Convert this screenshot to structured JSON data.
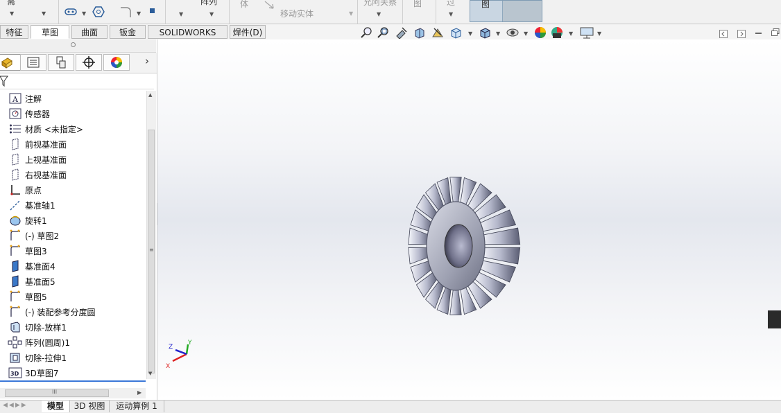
{
  "ribbon": {
    "partial_labels": [
      "需",
      "体",
      "阵列",
      "允阿关察",
      "图",
      "过"
    ],
    "move_body": "移动实体",
    "active_cell": "图"
  },
  "tabs": [
    {
      "label": "特征"
    },
    {
      "label": "草图",
      "active": true
    },
    {
      "label": "曲面"
    },
    {
      "label": "钣金"
    },
    {
      "label": "SOLIDWORKS MBD"
    },
    {
      "label": "焊件(D)"
    }
  ],
  "panel_tabs": [
    {
      "icon": "feature-manager-icon"
    },
    {
      "icon": "property-manager-icon"
    },
    {
      "icon": "configuration-manager-icon"
    },
    {
      "icon": "dimxpert-manager-icon"
    },
    {
      "icon": "display-manager-icon"
    }
  ],
  "panel_more": "›",
  "tree": [
    {
      "label": "注解",
      "icon": "annotation-icon"
    },
    {
      "label": "传感器",
      "icon": "sensor-icon"
    },
    {
      "label": "材质 <未指定>",
      "icon": "material-icon"
    },
    {
      "label": "前视基准面",
      "icon": "plane-icon"
    },
    {
      "label": "上视基准面",
      "icon": "plane-icon"
    },
    {
      "label": "右视基准面",
      "icon": "plane-icon"
    },
    {
      "label": "原点",
      "icon": "origin-icon"
    },
    {
      "label": "基准轴1",
      "icon": "axis-icon"
    },
    {
      "label": "旋转1",
      "icon": "revolve-icon"
    },
    {
      "label": "(-) 草图2",
      "icon": "sketch-icon"
    },
    {
      "label": "草图3",
      "icon": "sketch-icon"
    },
    {
      "label": "基准面4",
      "icon": "plane-solid-icon"
    },
    {
      "label": "基准面5",
      "icon": "plane-solid-icon"
    },
    {
      "label": "草图5",
      "icon": "sketch-icon"
    },
    {
      "label": "(-) 装配参考分度圆",
      "icon": "sketch-icon"
    },
    {
      "label": "切除-放样1",
      "icon": "cut-loft-icon"
    },
    {
      "label": "阵列(圆周)1",
      "icon": "circular-pattern-icon"
    },
    {
      "label": "切除-拉伸1",
      "icon": "cut-extrude-icon"
    },
    {
      "label": "3D草图7",
      "icon": "sketch3d-icon"
    }
  ],
  "bottom_tabs": [
    {
      "label": "模型",
      "active": true
    },
    {
      "label": "3D 视图"
    },
    {
      "label": "运动算例 1"
    }
  ],
  "triad": {
    "x": "X",
    "y": "Y",
    "z": "Z"
  },
  "hscroll_grip": "III"
}
